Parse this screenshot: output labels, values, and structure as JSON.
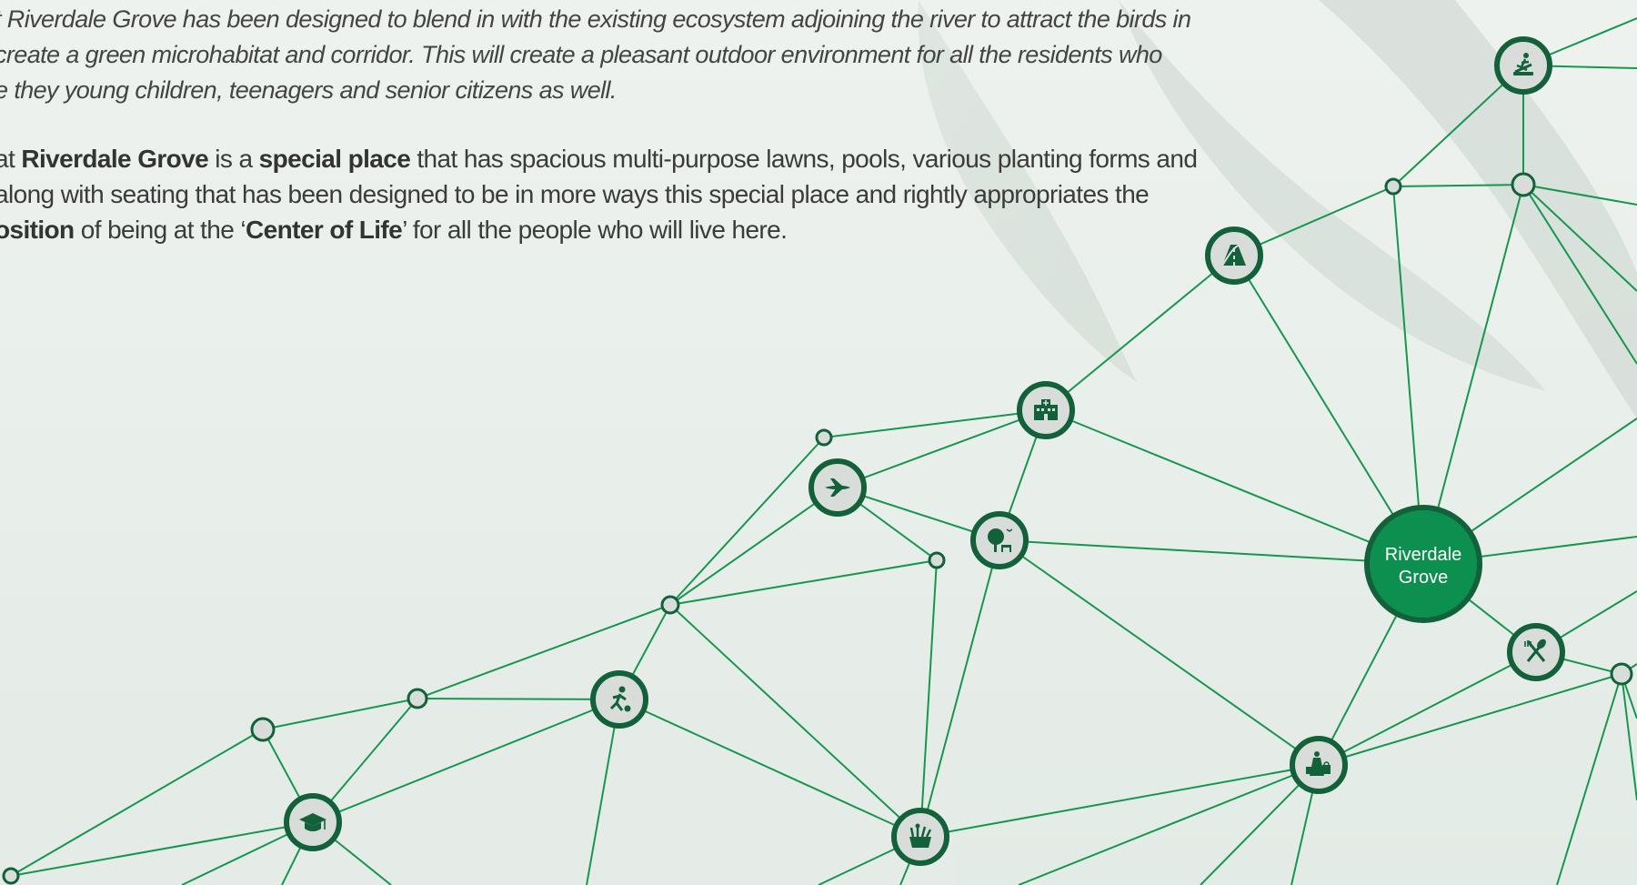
{
  "intro": {
    "line1": "t Riverdale Grove has been designed to blend in with the existing ecosystem adjoining the river to attract the birds in",
    "line2": "create a green microhabitat and corridor. This will create a pleasant outdoor environment for all the residents who",
    "line3": "e they young children, teenagers and senior citizens as well."
  },
  "body": {
    "l1_a": "at ",
    "l1_b1": "Riverdale Grove",
    "l1_c": " is a ",
    "l1_b2": "special place",
    "l1_d": " that has spacious multi-purpose lawns, pools, various planting forms and",
    "l2": "along with seating that has been designed to be in more ways this special place and rightly appropriates the",
    "l3_b1": "osition",
    "l3_c": " of being at the ‘",
    "l3_b2": "Center of Life",
    "l3_d": "’ for all the people who will live here."
  },
  "hub": {
    "line1": "Riverdale",
    "line2": "Grove"
  },
  "colors": {
    "accent": "#0d8f4f",
    "ring": "#12613b",
    "line": "#17964f",
    "node_fill": "#d9ddda"
  },
  "icons": [
    "gym-icon",
    "road-icon",
    "hospital-icon",
    "airport-icon",
    "park-icon",
    "sports-icon",
    "education-icon",
    "grocery-icon",
    "shopping-icon",
    "restaurant-icon"
  ]
}
